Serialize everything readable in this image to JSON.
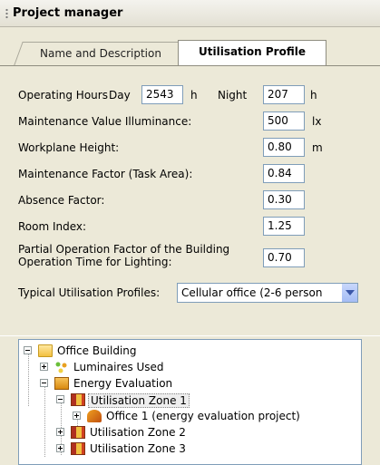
{
  "window": {
    "title": "Project manager"
  },
  "tabs": [
    {
      "label": "Name and Description",
      "active": false
    },
    {
      "label": "Utilisation Profile",
      "active": true
    }
  ],
  "form": {
    "operating_hours": {
      "label": "Operating Hours",
      "day_label": "Day",
      "day_value": "2543",
      "day_unit": "h",
      "night_label": "Night",
      "night_value": "207",
      "night_unit": "h"
    },
    "maintenance_illuminance": {
      "label": "Maintenance Value Illuminance:",
      "value": "500",
      "unit": "lx"
    },
    "workplane_height": {
      "label": "Workplane Height:",
      "value": "0.80",
      "unit": "m"
    },
    "maintenance_factor": {
      "label": "Maintenance Factor (Task Area):",
      "value": "0.84"
    },
    "absence_factor": {
      "label": "Absence Factor:",
      "value": "0.30"
    },
    "room_index": {
      "label": "Room Index:",
      "value": "1.25"
    },
    "partial_operation": {
      "label_line1": "Partial Operation Factor of the Building",
      "label_line2": "Operation Time for Lighting:",
      "value": "0.70"
    },
    "typical_profiles": {
      "label": "Typical Utilisation Profiles:",
      "selected": "Cellular office (2-6 person"
    }
  },
  "tree": {
    "root": "Office Building",
    "luminaires": "Luminaires Used",
    "energy": "Energy Evaluation",
    "zone1": "Utilisation Zone 1",
    "office1": "Office 1 (energy evaluation project)",
    "zone2": "Utilisation Zone 2",
    "zone3": "Utilisation Zone 3"
  }
}
